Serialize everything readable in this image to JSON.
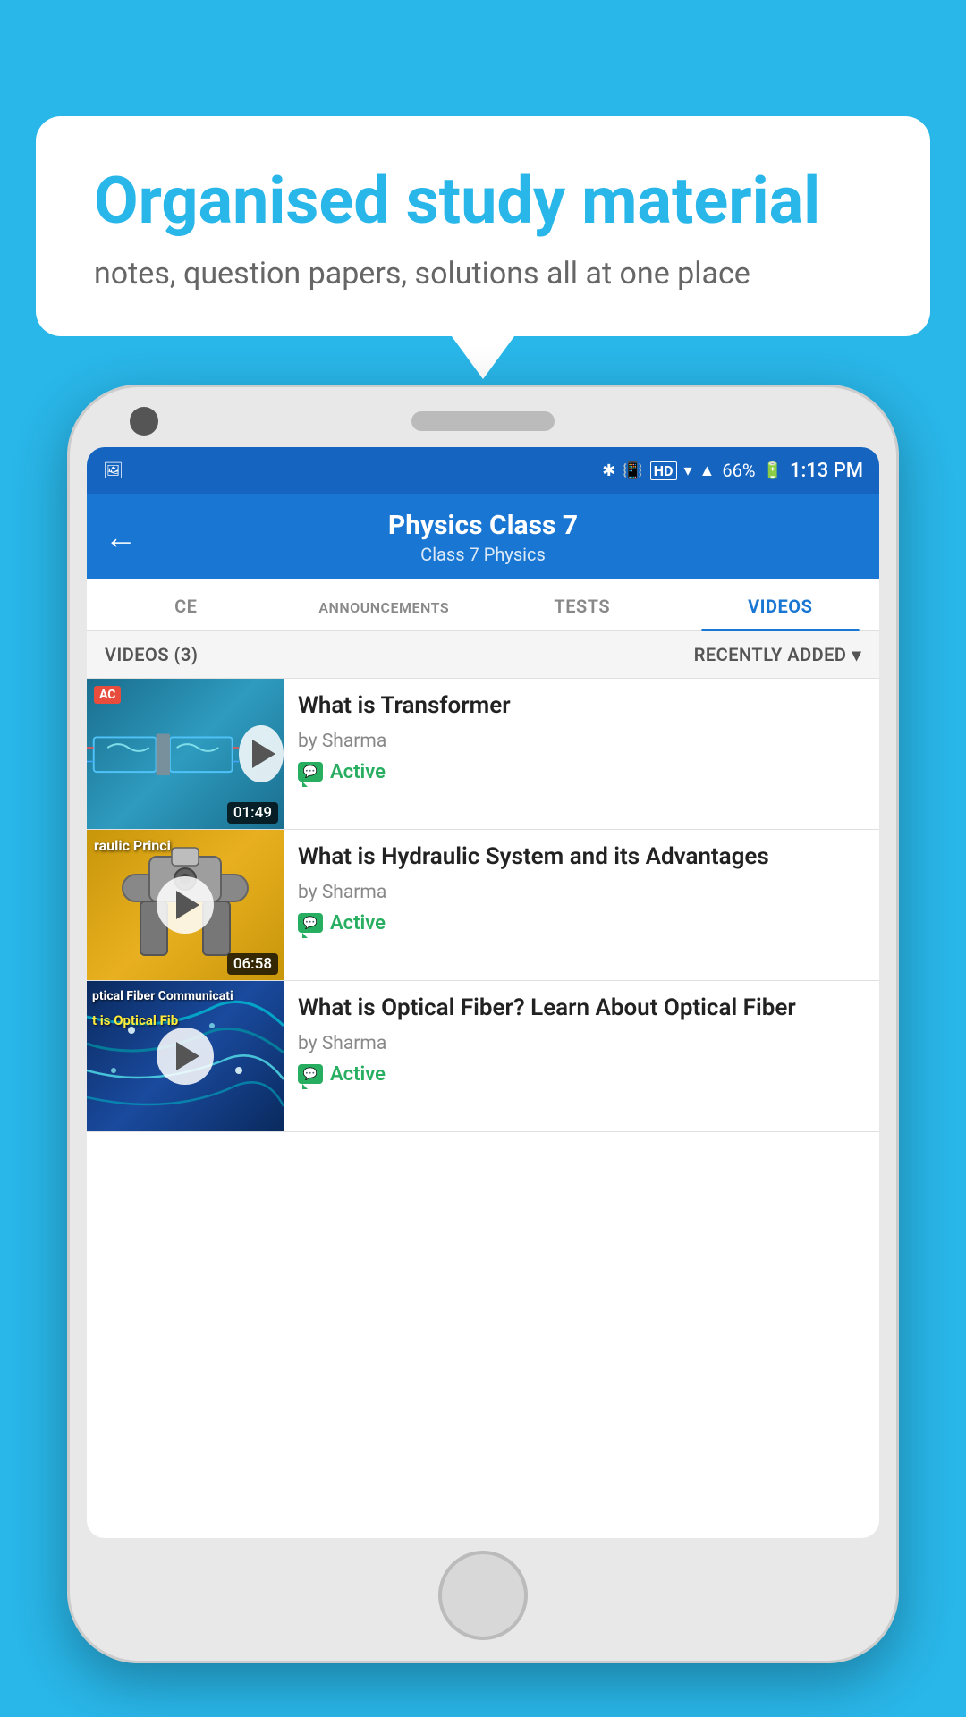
{
  "background_color": "#29b6e8",
  "speech_bubble": {
    "title": "Organised study material",
    "subtitle": "notes, question papers, solutions all at one place"
  },
  "status_bar": {
    "battery": "66%",
    "time": "1:13 PM",
    "signal": "HD"
  },
  "app_header": {
    "title": "Physics Class 7",
    "breadcrumb": "Class 7    Physics",
    "back_label": "←"
  },
  "tabs": [
    {
      "id": "ce",
      "label": "CE",
      "active": false
    },
    {
      "id": "announcements",
      "label": "ANNOUNCEMENTS",
      "active": false
    },
    {
      "id": "tests",
      "label": "TESTS",
      "active": false
    },
    {
      "id": "videos",
      "label": "VIDEOS",
      "active": true
    }
  ],
  "filter_bar": {
    "count_label": "VIDEOS (3)",
    "sort_label": "RECENTLY ADDED",
    "chevron": "▾"
  },
  "videos": [
    {
      "id": 1,
      "title": "What is  Transformer",
      "author": "by Sharma",
      "status": "Active",
      "duration": "01:49",
      "thumb_type": "transformer",
      "thumb_label": "AC"
    },
    {
      "id": 2,
      "title": "What is Hydraulic System and its Advantages",
      "author": "by Sharma",
      "status": "Active",
      "duration": "06:58",
      "thumb_type": "hydraulic",
      "thumb_label": "raulic Princi"
    },
    {
      "id": 3,
      "title": "What is Optical Fiber? Learn About Optical Fiber",
      "author": "by Sharma",
      "status": "Active",
      "duration": "",
      "thumb_type": "optical",
      "thumb_label": "ptical Fiber Communicati",
      "thumb_label2": "t is Optical Fib"
    }
  ]
}
